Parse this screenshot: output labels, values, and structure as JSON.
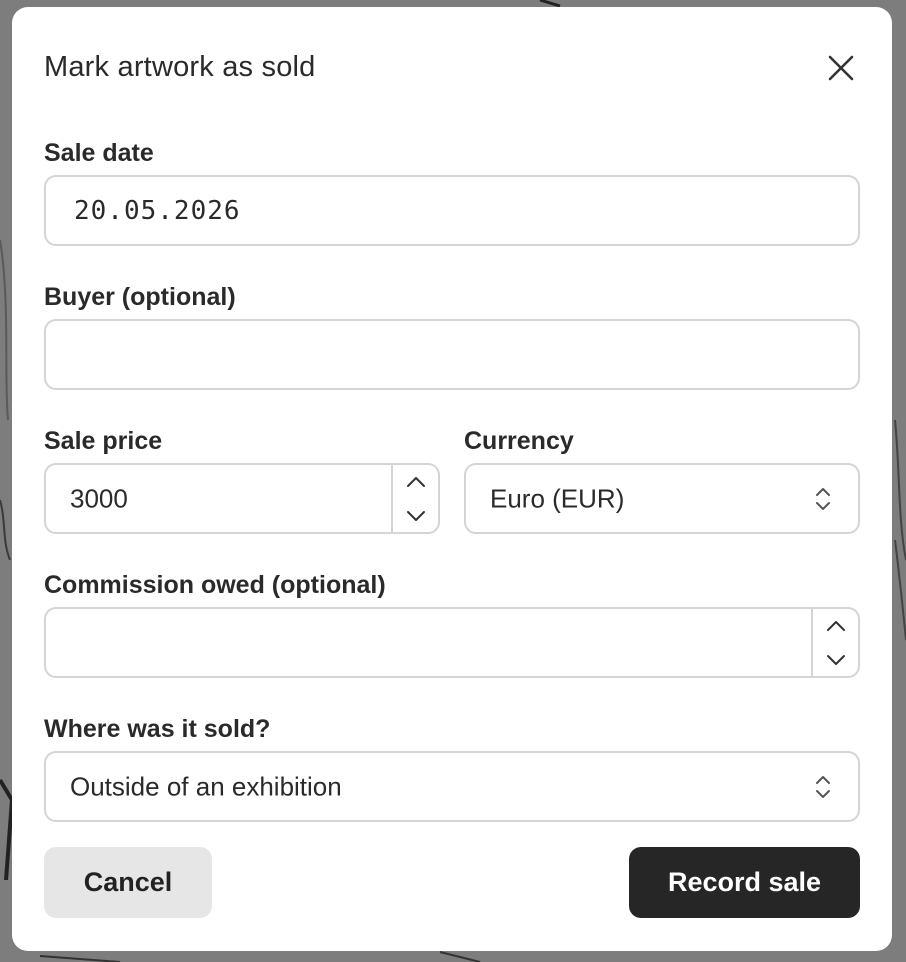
{
  "dialog": {
    "title": "Mark artwork as sold",
    "close_icon": "close-icon"
  },
  "fields": {
    "sale_date": {
      "label": "Sale date",
      "value": "20.05.2026"
    },
    "buyer": {
      "label": "Buyer (optional)",
      "value": ""
    },
    "sale_price": {
      "label": "Sale price",
      "value": "3000",
      "icons": [
        "chevron-up-icon",
        "chevron-down-icon"
      ]
    },
    "currency": {
      "label": "Currency",
      "selected": "Euro (EUR)",
      "icon": "select-arrows-icon"
    },
    "commission": {
      "label": "Commission owed (optional)",
      "value": "",
      "icons": [
        "chevron-up-icon",
        "chevron-down-icon"
      ]
    },
    "location": {
      "label": "Where was it sold?",
      "selected": "Outside of an exhibition",
      "icon": "select-arrows-icon"
    }
  },
  "actions": {
    "cancel_label": "Cancel",
    "submit_label": "Record sale"
  },
  "colors": {
    "primary_button": "#262626",
    "secondary_button": "#e6e6e6",
    "border": "#d4d4d4",
    "backdrop": "#7d7d7d"
  }
}
